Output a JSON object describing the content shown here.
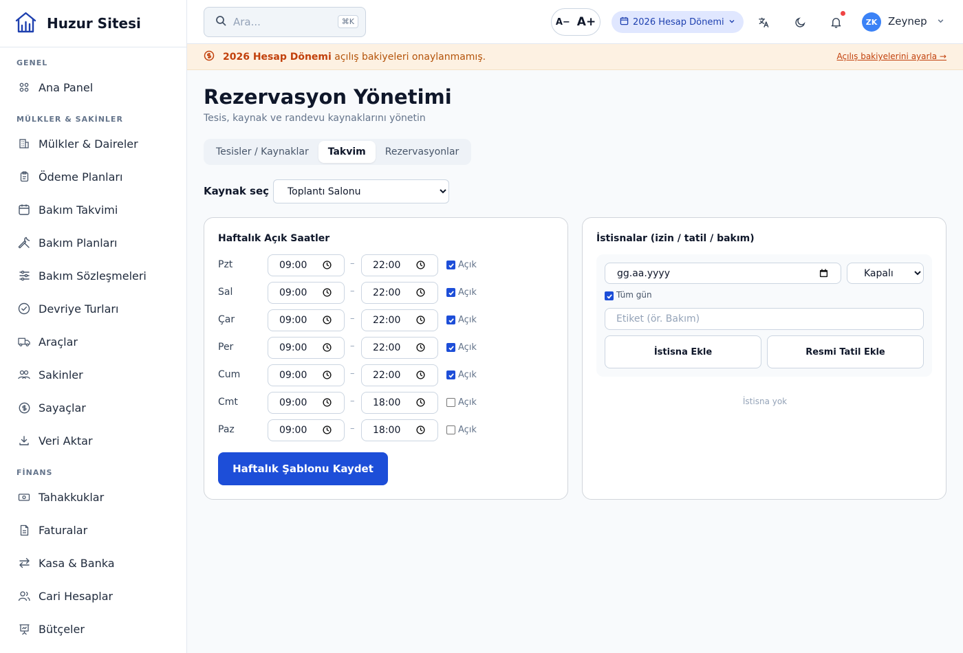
{
  "brand": {
    "name": "Huzur Sitesi"
  },
  "sidebar": {
    "sections": [
      {
        "title": "GENEL",
        "items": [
          {
            "label": "Ana Panel",
            "icon": "grid-icon"
          }
        ]
      },
      {
        "title": "MÜLKLER & SAKİNLER",
        "items": [
          {
            "label": "Mülkler & Daireler",
            "icon": "building-icon"
          },
          {
            "label": "Ödeme Planları",
            "icon": "clipboard-icon"
          },
          {
            "label": "Bakım Takvimi",
            "icon": "calendar-icon"
          },
          {
            "label": "Bakım Planları",
            "icon": "wrench-icon"
          },
          {
            "label": "Bakım Sözleşmeleri",
            "icon": "sliders-icon"
          },
          {
            "label": "Devriye Turları",
            "icon": "check-circle-icon"
          },
          {
            "label": "Araçlar",
            "icon": "truck-icon"
          },
          {
            "label": "Sakinler",
            "icon": "users-icon"
          },
          {
            "label": "Sayaçlar",
            "icon": "dollar-circle-icon"
          },
          {
            "label": "Veri Aktar",
            "icon": "download-icon"
          }
        ]
      },
      {
        "title": "FİNANS",
        "items": [
          {
            "label": "Tahakkuklar",
            "icon": "banknote-icon"
          },
          {
            "label": "Faturalar",
            "icon": "file-icon"
          },
          {
            "label": "Kasa & Banka",
            "icon": "transfer-icon"
          },
          {
            "label": "Cari Hesaplar",
            "icon": "people-icon"
          },
          {
            "label": "Bütçeler",
            "icon": "presentation-icon"
          }
        ]
      }
    ]
  },
  "topbar": {
    "search_placeholder": "Ara...",
    "search_shortcut": "⌘K",
    "font_decrease": "A−",
    "font_increase": "A+",
    "period": "2026 Hesap Dönemi",
    "user_initials": "ZK",
    "user_name": "Zeynep"
  },
  "banner": {
    "bold": "2026 Hesap Dönemi",
    "text": " açılış bakiyeleri onaylanmamış.",
    "link": "Açılış bakiyelerini ayarla →"
  },
  "page": {
    "title": "Rezervasyon Yönetimi",
    "subtitle": "Tesis, kaynak ve randevu kaynaklarını yönetin",
    "tabs": [
      "Tesisler / Kaynaklar",
      "Takvim",
      "Rezervasyonlar"
    ],
    "active_tab": 1,
    "resource_label": "Kaynak seç",
    "resource_selected": "Toplantı Salonu"
  },
  "weekly": {
    "title": "Haftalık Açık Saatler",
    "open_label": "Açık",
    "separator": "–",
    "days": [
      {
        "day": "Pzt",
        "start": "09:00",
        "end": "22:00",
        "open": true
      },
      {
        "day": "Sal",
        "start": "09:00",
        "end": "22:00",
        "open": true
      },
      {
        "day": "Çar",
        "start": "09:00",
        "end": "22:00",
        "open": true
      },
      {
        "day": "Per",
        "start": "09:00",
        "end": "22:00",
        "open": true
      },
      {
        "day": "Cum",
        "start": "09:00",
        "end": "22:00",
        "open": true
      },
      {
        "day": "Cmt",
        "start": "09:00",
        "end": "18:00",
        "open": false
      },
      {
        "day": "Paz",
        "start": "09:00",
        "end": "18:00",
        "open": false
      }
    ],
    "save_button": "Haftalık Şablonu Kaydet"
  },
  "exceptions": {
    "title": "İstisnalar (izin / tatil / bakım)",
    "date_placeholder": "gg.aa.yyyy",
    "state_selected": "Kapalı",
    "all_day_label": "Tüm gün",
    "all_day_checked": true,
    "label_placeholder": "Etiket (ör. Bakım)",
    "add_button": "İstisna Ekle",
    "holiday_button": "Resmi Tatil Ekle",
    "empty_text": "İstisna yok"
  }
}
